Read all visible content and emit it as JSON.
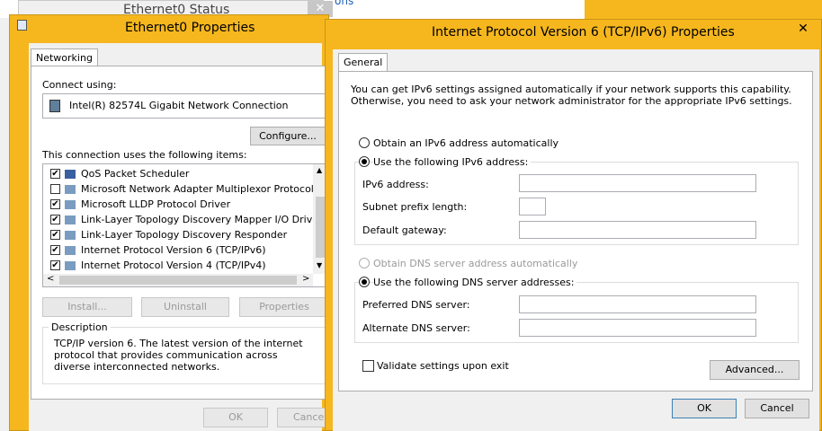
{
  "background": {
    "status_title": "Ethernet0 Status",
    "link_fragment": "ons",
    "close_glyph": "✕"
  },
  "eth_dialog": {
    "title": "Ethernet0 Properties",
    "tab": "Networking",
    "connect_using_label": "Connect using:",
    "adapter_name": "Intel(R) 82574L Gigabit Network Connection",
    "configure_button": "Configure...",
    "items_label": "This connection uses the following items:",
    "items": [
      {
        "label": "QoS Packet Scheduler",
        "checked": true
      },
      {
        "label": "Microsoft Network Adapter Multiplexor Protocol",
        "checked": false
      },
      {
        "label": "Microsoft LLDP Protocol Driver",
        "checked": true
      },
      {
        "label": "Link-Layer Topology Discovery Mapper I/O Driver",
        "checked": true
      },
      {
        "label": "Link-Layer Topology Discovery Responder",
        "checked": true
      },
      {
        "label": "Internet Protocol Version 6 (TCP/IPv6)",
        "checked": true
      },
      {
        "label": "Internet Protocol Version 4 (TCP/IPv4)",
        "checked": true
      }
    ],
    "install_button": "Install...",
    "uninstall_button": "Uninstall",
    "properties_button": "Properties",
    "description_label": "Description",
    "description_text": "TCP/IP version 6. The latest version of the internet protocol that provides communication across diverse interconnected networks.",
    "ok_button": "OK",
    "cancel_button": "Cancel"
  },
  "ipv6_dialog": {
    "title": "Internet Protocol Version 6 (TCP/IPv6) Properties",
    "close_glyph": "✕",
    "tab": "General",
    "intro_line1": "You can get IPv6 settings assigned automatically if your network supports this capability.",
    "intro_line2": "Otherwise, you need to ask your network administrator for the appropriate IPv6 settings.",
    "auto_address_label": "Obtain an IPv6 address automatically",
    "manual_address_label": "Use the following IPv6 address:",
    "ipv6_address_label": "IPv6 address:",
    "ipv6_address_value": "",
    "prefix_length_label": "Subnet prefix length:",
    "prefix_length_value": "",
    "gateway_label": "Default gateway:",
    "gateway_value": "",
    "auto_dns_label": "Obtain DNS server address automatically",
    "manual_dns_label": "Use the following DNS server addresses:",
    "preferred_dns_label": "Preferred DNS server:",
    "preferred_dns_value": "",
    "alternate_dns_label": "Alternate DNS server:",
    "alternate_dns_value": "",
    "validate_label": "Validate settings upon exit",
    "validate_checked": false,
    "advanced_button": "Advanced...",
    "ok_button": "OK",
    "cancel_button": "Cancel"
  },
  "colors": {
    "window_frame": "#f6b71e",
    "dialog_face": "#f0f0f0",
    "disabled_text": "#9a9a9a"
  }
}
